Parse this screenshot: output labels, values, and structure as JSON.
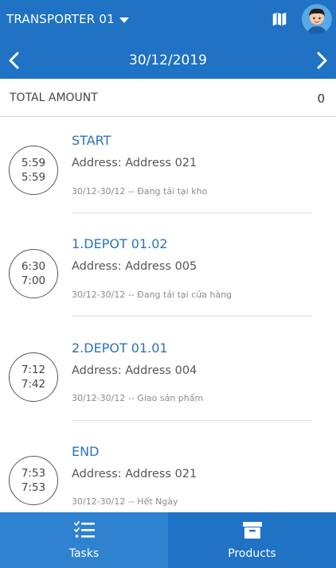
{
  "header": {
    "transporter_label": "TRANSPORTER 01",
    "date": "30/12/2019"
  },
  "total": {
    "label": "TOTAL AMOUNT",
    "value": "0"
  },
  "stops": [
    {
      "time_start": "5:59",
      "time_end": "5:59",
      "title": "START",
      "address": "Address: Address 021",
      "meta": "30/12-30/12 -- Đang tải tại kho"
    },
    {
      "time_start": "6:30",
      "time_end": "7:00",
      "title": "1.DEPOT 01.02",
      "address": "Address: Address 005",
      "meta": "30/12-30/12 -- Đang tải tại cửa hàng"
    },
    {
      "time_start": "7:12",
      "time_end": "7:42",
      "title": "2.DEPOT 01.01",
      "address": "Address: Address 004",
      "meta": "30/12-30/12 -- Giao sản phẩm"
    },
    {
      "time_start": "7:53",
      "time_end": "7:53",
      "title": "END",
      "address": "Address: Address 021",
      "meta": "30/12-30/12 -- Hết Ngày"
    }
  ],
  "tabs": {
    "tasks_label": "Tasks",
    "products_label": "Products"
  },
  "icons": {
    "map": "map-icon",
    "avatar": "avatar",
    "prev": "chevron-left-icon",
    "next": "chevron-right-icon",
    "tasks": "task-list-icon",
    "products": "archive-box-icon"
  },
  "colors": {
    "primary": "#1f72c4",
    "active_tab": "#2f82cf",
    "title_blue": "#2b73b8"
  }
}
